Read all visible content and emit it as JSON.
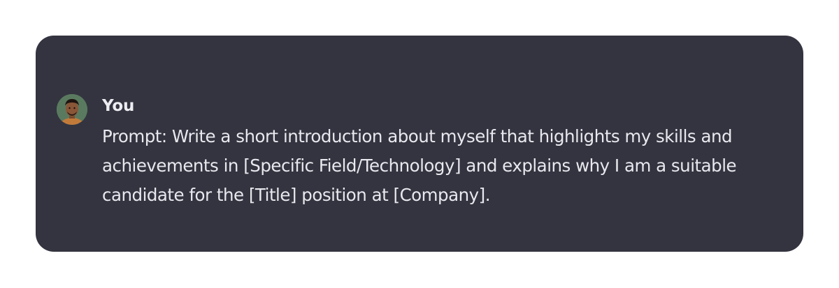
{
  "message": {
    "author": "You",
    "avatar_icon": "user-avatar",
    "text": "Prompt: Write a short introduction about myself that highlights my skills and achievements in [Specific Field/Technology] and explains why I am a suitable candidate for the [Title] position at [Company]."
  },
  "colors": {
    "card_background": "#343440",
    "page_background": "#ffffff",
    "text": "#ececf1"
  }
}
